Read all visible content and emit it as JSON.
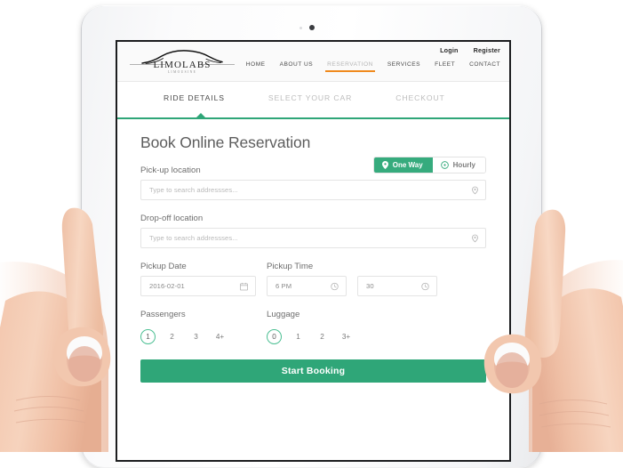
{
  "device": {
    "type": "tablet",
    "camera": "front-camera"
  },
  "site": {
    "logo": {
      "name": "LIMOLABS",
      "subtitle": "LIMOUSINE",
      "icon": "car-silhouette-icon"
    },
    "auth": [
      {
        "label": "Login"
      },
      {
        "label": "Register"
      }
    ],
    "nav": [
      {
        "label": "HOME",
        "active": false
      },
      {
        "label": "ABOUT US",
        "active": false
      },
      {
        "label": "RESERVATION",
        "active": true
      },
      {
        "label": "SERVICES",
        "active": false
      },
      {
        "label": "FLEET",
        "active": false
      },
      {
        "label": "CONTACT",
        "active": false
      }
    ],
    "accent_orange": "#f08a1e",
    "accent_green": "#2fa678"
  },
  "steps": [
    {
      "label": "RIDE DETAILS",
      "active": true
    },
    {
      "label": "SELECT YOUR CAR",
      "active": false
    },
    {
      "label": "CHECKOUT",
      "active": false
    }
  ],
  "form": {
    "title": "Book Online Reservation",
    "trip_toggle": {
      "options": [
        {
          "label": "One Way",
          "icon": "map-pin-icon",
          "active": true
        },
        {
          "label": "Hourly",
          "icon": "clock-icon",
          "active": false
        }
      ]
    },
    "pickup_location": {
      "label": "Pick-up location",
      "placeholder": "Type to search addressses...",
      "value": "",
      "icon": "map-pin-icon"
    },
    "dropoff_location": {
      "label": "Drop-off location",
      "placeholder": "Type to search addressses...",
      "value": "",
      "icon": "map-pin-icon"
    },
    "pickup_date": {
      "label": "Pickup Date",
      "value": "2016-02-01",
      "icon": "calendar-icon"
    },
    "pickup_time": {
      "label": "Pickup Time",
      "hour": "6 PM",
      "minute": "30",
      "icon": "clock-icon"
    },
    "passengers": {
      "label": "Passengers",
      "options": [
        "1",
        "2",
        "3",
        "4+"
      ],
      "selected": "1"
    },
    "luggage": {
      "label": "Luggage",
      "options": [
        "0",
        "1",
        "2",
        "3+"
      ],
      "selected": "0"
    },
    "submit": {
      "label": "Start Booking"
    }
  }
}
